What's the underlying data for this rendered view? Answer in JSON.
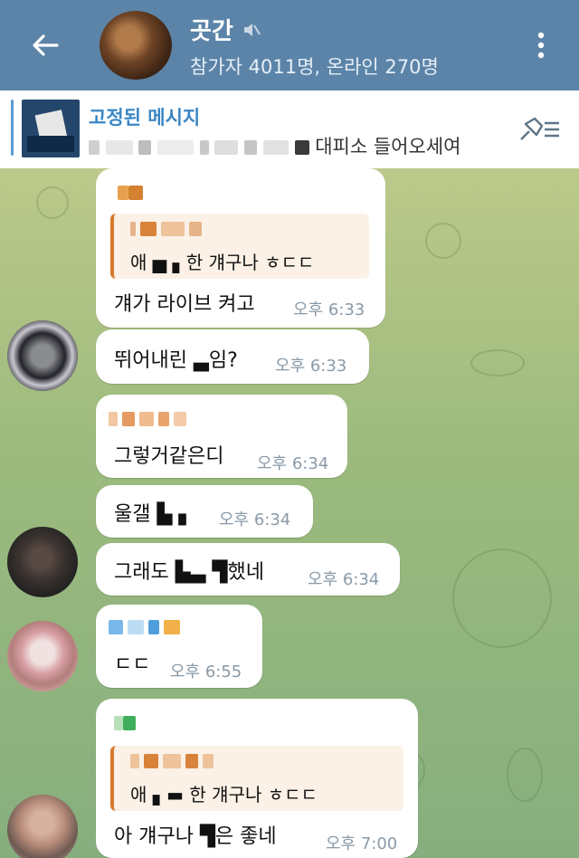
{
  "header": {
    "title": "곳간",
    "subtitle": "참가자 4011명, 온라인 270명"
  },
  "pinned": {
    "title": "고정된 메시지",
    "text": "대피소 들어오세여"
  },
  "messages": [
    {
      "quote": "애 ▅ ▖한 걔구나 ㅎㄷㄷ",
      "text": "걔가 라이브 켜고",
      "time": "오후 6:33"
    },
    {
      "text": "뛰어내린 ▃임?",
      "time": "오후 6:33"
    },
    {
      "text": "그렇거같은디",
      "time": "오후 6:34"
    },
    {
      "text": "울갤 ▙ ▖",
      "time": "오후 6:34"
    },
    {
      "text": "그래도 ▙▃ ▜했네",
      "time": "오후 6:34"
    },
    {
      "text": "ㄷㄷ",
      "time": "오후 6:55"
    },
    {
      "quote": "애 ▖▬ 한 걔구나 ㅎㄷㄷ",
      "text": "아 걔구나 ▜은 좋네",
      "time": "오후 7:00"
    }
  ],
  "colors": {
    "header": "#5b84a8",
    "accent": "#3a86c4",
    "quote_bar": "#d77a2e"
  }
}
